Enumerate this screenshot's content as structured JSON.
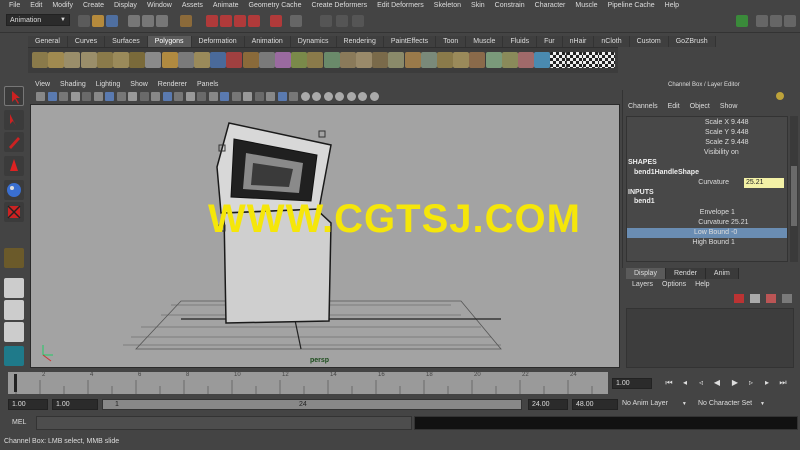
{
  "menubar": [
    "File",
    "Edit",
    "Modify",
    "Create",
    "Display",
    "Window",
    "Assets",
    "Animate",
    "Geometry Cache",
    "Create Deformers",
    "Edit Deformers",
    "Skeleton",
    "Skin",
    "Constrain",
    "Character",
    "Muscle",
    "Pipeline Cache",
    "Help"
  ],
  "status": {
    "mode": "Animation"
  },
  "shelf_tabs": [
    "General",
    "Curves",
    "Surfaces",
    "Polygons",
    "Deformation",
    "Animation",
    "Dynamics",
    "Rendering",
    "PaintEffects",
    "Toon",
    "Muscle",
    "Fluids",
    "Fur",
    "nHair",
    "nCloth",
    "Custom",
    "GoZBrush"
  ],
  "active_shelf_tab": "Polygons",
  "panel_menu": [
    "View",
    "Shading",
    "Lighting",
    "Show",
    "Renderer",
    "Panels"
  ],
  "viewport": {
    "camera_label": "persp",
    "watermark": "WWW.CGTSJ.COM"
  },
  "channel_box": {
    "title": "Channel Box / Layer Editor",
    "menu": [
      "Channels",
      "Edit",
      "Object",
      "Show"
    ],
    "transform_rows": [
      {
        "label": "Scale X",
        "value": "9.448"
      },
      {
        "label": "Scale Y",
        "value": "9.448"
      },
      {
        "label": "Scale Z",
        "value": "9.448"
      },
      {
        "label": "Visibility",
        "value": "on"
      }
    ],
    "shapes_header": "SHAPES",
    "shape_name": "bend1HandleShape",
    "shape_rows": [
      {
        "label": "Curvature",
        "value": "25.21"
      }
    ],
    "inputs_header": "INPUTS",
    "input_name": "bend1",
    "input_rows": [
      {
        "label": "Envelope",
        "value": "1"
      },
      {
        "label": "Curvature",
        "value": "25.21"
      },
      {
        "label": "Low Bound",
        "value": "-0"
      },
      {
        "label": "High Bound",
        "value": "1"
      }
    ]
  },
  "layer_editor": {
    "tabs": [
      "Display",
      "Render",
      "Anim"
    ],
    "active_tab": "Display",
    "menu": [
      "Layers",
      "Options",
      "Help"
    ]
  },
  "timeline": {
    "ticks": [
      "2",
      "4",
      "6",
      "8",
      "10",
      "12",
      "14",
      "16",
      "18",
      "20",
      "22",
      "24"
    ],
    "current_frame": "1.00"
  },
  "range": {
    "start_outer": "1.00",
    "start_inner": "1.00",
    "slider_start": "1",
    "slider_end": "24",
    "end_inner": "24.00",
    "end_outer": "48.00",
    "anim_layer": "No Anim Layer",
    "character_set": "No Character Set"
  },
  "command": {
    "label": "MEL"
  },
  "help_line": "Channel Box: LMB select, MMB slide",
  "colors": {
    "watermark": "#f5e60a",
    "viewport_bg": "#a3a3a3",
    "highlight_row": "#6a8db3"
  }
}
